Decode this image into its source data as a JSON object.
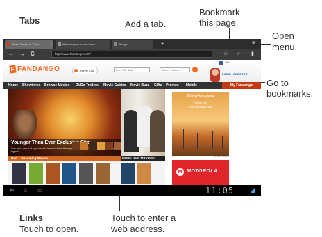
{
  "callouts": {
    "tabs": "Tabs",
    "add_tab": "Add a tab.",
    "bookmark_line1": "Bookmark",
    "bookmark_line2": "this page.",
    "open_line1": "Open",
    "open_line2": "menu.",
    "goto_line1": "Go to",
    "goto_line2": "bookmarks.",
    "links_title": "Links",
    "links_sub": "Touch to open.",
    "address_line1": "Touch to enter a",
    "address_line2": "web address."
  },
  "browser": {
    "tabs": [
      {
        "label": "Movie Tickets & Thea..."
      },
      {
        "label": "Motorola phones and acc..."
      },
      {
        "label": "Google"
      }
    ],
    "new_tab_glyph": "+",
    "url": "http://www.fandango.com/",
    "back_glyph": "←",
    "forward_glyph": "→",
    "refresh_glyph": "C",
    "bookmark_glyph": "☆",
    "search_glyph": "⌕",
    "bookmarks_glyph": "▮",
    "menu_glyph": "≡"
  },
  "site": {
    "logo": "FANDANGO",
    "logo_mark": "F",
    "movie_list": "Movie List",
    "search_location": "Enter City, State",
    "search_movies": "Movies + Actors",
    "like": "Like",
    "login": "LOGIN | REGISTER",
    "nav": [
      "Home",
      "Showtimes",
      "Browse Movies",
      "DVDs",
      "Trailers",
      "Movie Guides",
      "Movie Buzz",
      "Gifts + Promos",
      "Mobile"
    ],
    "my_fandango": "My Fandango",
    "hero_title": "Younger Than Ever Exclusive Clip",
    "hero_sub": "Tom and a group of boys head to Israel to leave the city that knows and find the treasures of the legend.",
    "upcoming": "New + Upcoming Movies",
    "more_new": "MORE NEW MOVIES >",
    "ad_title": "TimeScapes",
    "ad_line1": "Coming 2011",
    "ad_line2": "Visit Timescapes.org",
    "ad_label": "ADVERTISEMENT",
    "moto_mark": "M",
    "moto": "MOTOROLA"
  },
  "system": {
    "back_glyph": "⇐",
    "home_glyph": "⌂",
    "recent_glyph": "▭",
    "clock": "11:05"
  },
  "colors": {
    "fandango_orange": "#f26a20",
    "motorola_red": "#e0262a"
  }
}
